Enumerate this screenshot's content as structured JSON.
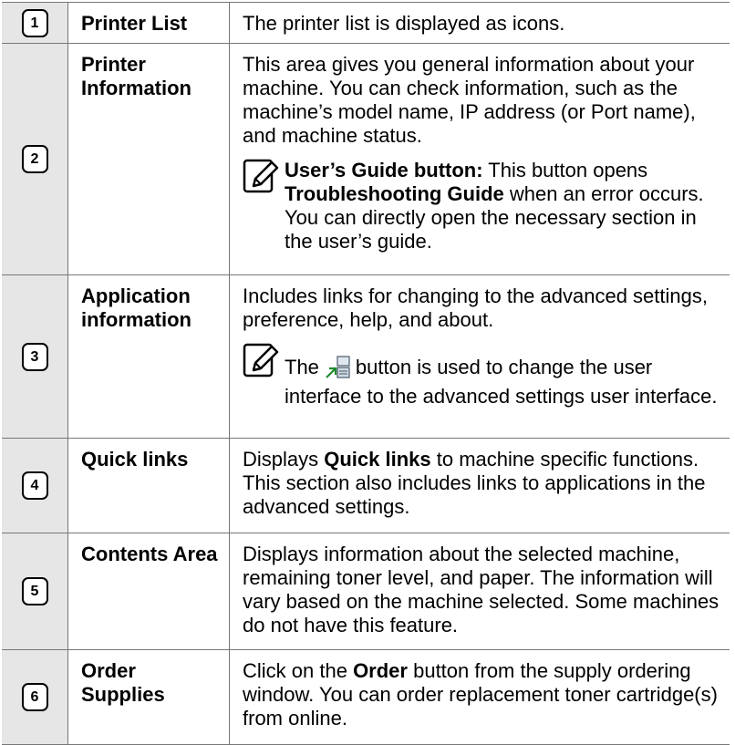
{
  "rows": [
    {
      "num": "1",
      "name": "Printer List",
      "description": "The printer list is displayed as icons."
    },
    {
      "num": "2",
      "name": "Printer Information",
      "description": "This area gives you general information about your machine. You can check information, such as the machine’s model name, IP address (or Port name), and machine status.",
      "note": {
        "icon": "note-icon",
        "bold_lead": "User’s Guide button:",
        "text_a": " This button opens ",
        "bold_mid": "Troubleshooting Guide",
        "text_b": " when an error occurs. You can directly open the necessary section in the user’s guide."
      }
    },
    {
      "num": "3",
      "name": "Application information",
      "description": "Includes links for changing to the advanced settings, preference, help, and about.",
      "note": {
        "icon": "note-icon",
        "text_a": "The",
        "inline_icon": "switch-ui-icon",
        "text_b": "button is used to change the user interface to the advanced settings user interface."
      }
    },
    {
      "num": "4",
      "name": "Quick links",
      "desc_a": "Displays ",
      "desc_bold": "Quick links",
      "desc_b": " to machine specific functions. This section also includes links to applications in the advanced settings."
    },
    {
      "num": "5",
      "name": "Contents Area",
      "description": "Displays information about the selected machine, remaining toner level, and paper. The information will vary based on the machine selected. Some machines do not have this feature."
    },
    {
      "num": "6",
      "name": "Order Supplies",
      "desc_a": "Click on the ",
      "desc_bold": "Order",
      "desc_b": " button from the supply ordering window. You can order replacement toner cartridge(s) from online."
    }
  ]
}
